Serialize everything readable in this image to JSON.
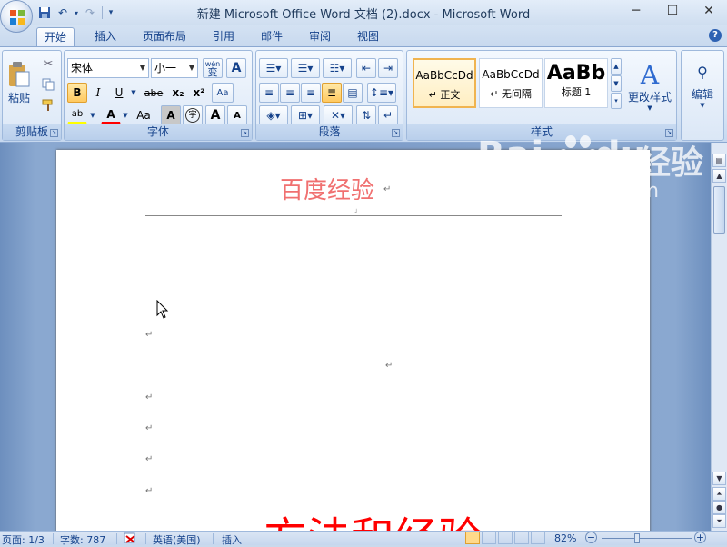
{
  "window": {
    "title": "新建 Microsoft Office Word 文档 (2).docx - Microsoft Word",
    "controls": {
      "minimize": "─",
      "maximize": "☐",
      "close": "✕"
    }
  },
  "quick_access": {
    "undo_glyph": "↶",
    "redo_glyph": "↷",
    "customize_glyph": "▾"
  },
  "tabs": [
    "开始",
    "插入",
    "页面布局",
    "引用",
    "邮件",
    "审阅",
    "视图"
  ],
  "active_tab": "开始",
  "help_label": "?",
  "ribbon": {
    "clipboard": {
      "label": "剪贴板",
      "paste": "粘贴"
    },
    "font": {
      "label": "字体",
      "font_name": "宋体",
      "font_size": "小一",
      "wen": "wén",
      "wen_char": "变",
      "char_border": "A",
      "bold": "B",
      "italic": "I",
      "underline": "U",
      "strike": "abe",
      "subscript": "x₂",
      "superscript": "x²",
      "clear_fmt": "Aa",
      "highlight": "ab",
      "font_color": "A",
      "change_case": "Aa",
      "char_shading": "A",
      "enclose": "字",
      "grow": "A",
      "shrink": "A"
    },
    "paragraph": {
      "label": "段落"
    },
    "styles": {
      "label": "样式",
      "items": [
        {
          "sample": "AaBbCcDd",
          "name": "↵ 正文"
        },
        {
          "sample": "AaBbCcDd",
          "name": "↵ 无间隔"
        },
        {
          "sample": "AaBb",
          "name": "标题 1"
        }
      ],
      "change_styles": "更改样式"
    },
    "editing": {
      "label": "编辑"
    }
  },
  "document": {
    "header_text": "百度经验",
    "para_mark": "↵",
    "body_heading": "方法和经验"
  },
  "watermark": {
    "brand": "Bai",
    "brand2": "du",
    "cn": "经验",
    "url": "jingyan.baidu.com"
  },
  "statusbar": {
    "page": "页面: 1/3",
    "words": "字数: 787",
    "language": "英语(美国)",
    "mode": "插入",
    "zoom": "82%"
  },
  "colors": {
    "header_text": "#f07070",
    "heading": "#ff0000",
    "accent": "#15428b"
  }
}
